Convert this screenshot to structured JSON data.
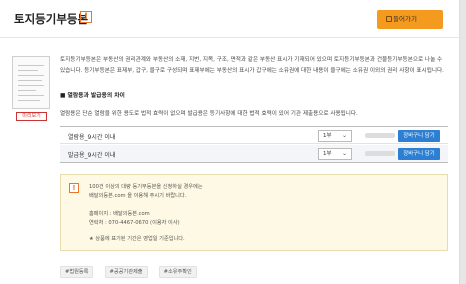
{
  "header": {
    "title": "토지등기부등본",
    "alert_icon": "!",
    "go_button": "들어가기"
  },
  "thumbnail": {
    "badge": "미리보기"
  },
  "description": {
    "p1": "토지등기부등본은 부동산의 권리관계와 부동산의 소재, 지번, 지목, 구조, 면적과 같은 부동산 표시가 기재되어 있으며 토지등기부등본과 건물등기부등본으로 나눌 수 있습니다. 등기부등본은 표제부, 갑구, 을구로 구성되며 표제부에는 부동산의 표시가 갑구에는 소유권에 대한 내용이 을구에는 소유권 이외의 권리 사항이 표시됩니다.",
    "subtitle": "■ 열람용과 발급용의 차이",
    "p2": "열람용은 단순 열람을 위한 용도로 법적 효력이 없으며 발급용은 등기사항에 대한 법적 효력이 있어 기관 제출용으로 사용됩니다."
  },
  "options": [
    {
      "label": "열람용_9시간 이내",
      "qty": "1부",
      "cart": "장바구니 담기"
    },
    {
      "label": "발급용_9시간 이내",
      "qty": "1부",
      "cart": "장바구니 담기"
    }
  ],
  "notice": {
    "line1": "100건 이상의 대량 등기부등본을 신청하실 경우에는",
    "line2": "배달의등본.com 을 이용해 주시기 바랍니다.",
    "line3": "홈페이지 : 배달의등본.com",
    "line4": "연락처 : 070-4467-0670 (이용자 이사)",
    "line5": "★ 상품에 표기된 기간은 영업일 기준입니다."
  },
  "tags": [
    "#법원등록",
    "#공공기관제출",
    "#소유주확인"
  ],
  "colors": {
    "accent": "#f39a1f",
    "cart_button": "#2d7fd3",
    "alert": "#e8772e"
  }
}
